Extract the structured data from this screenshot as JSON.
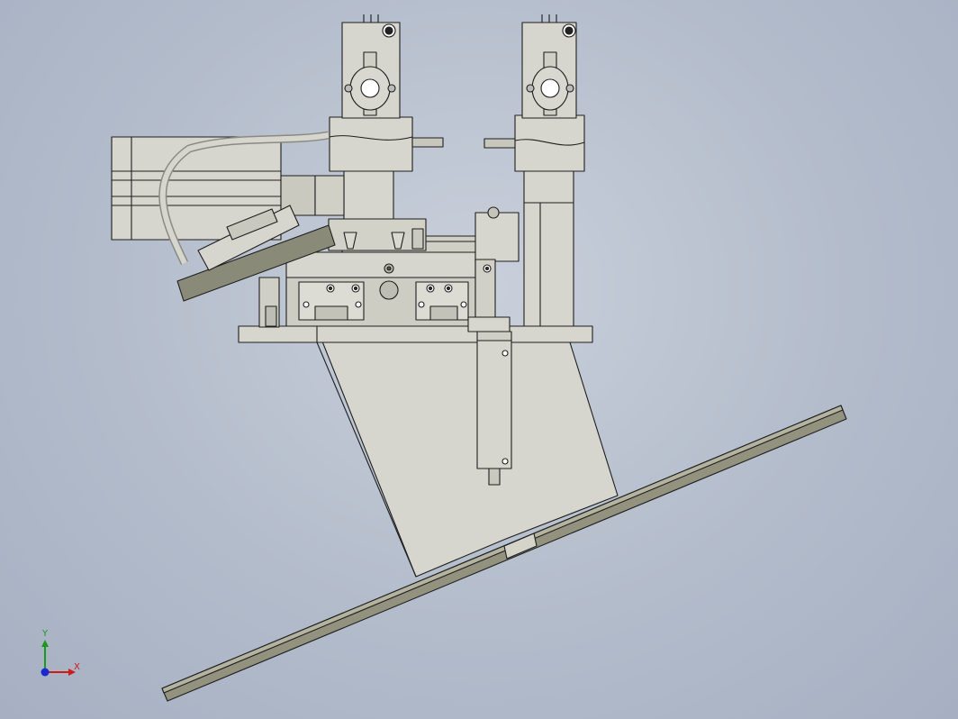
{
  "triad": {
    "x_label": "X",
    "y_label": "Y"
  },
  "colors": {
    "background": "#b8c1cf",
    "part_fill": "#d6d6ce",
    "part_dark": "#b9b9b0",
    "edge": "#1e1e1e",
    "plate_fill": "#8f8f80",
    "axis_x": "#d01a1a",
    "axis_y": "#1a9a1a",
    "axis_z": "#1a2ad0"
  }
}
